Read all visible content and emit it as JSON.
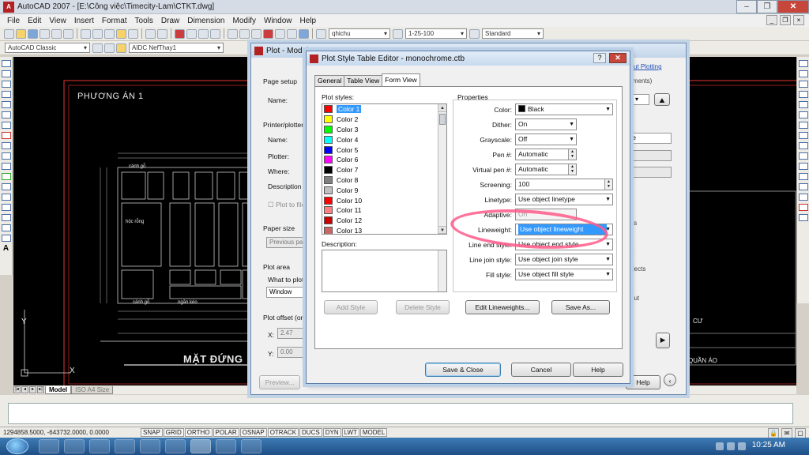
{
  "window": {
    "title": "AutoCAD 2007 - [E:\\Công việc\\Timecity-Lam\\CTKT.dwg]"
  },
  "menu": [
    "File",
    "Edit",
    "View",
    "Insert",
    "Format",
    "Tools",
    "Draw",
    "Dimension",
    "Modify",
    "Window",
    "Help"
  ],
  "toolbar": {
    "text_style": "qhichu",
    "dim_scale": "1-25-100",
    "table_style": "Standard",
    "workspace": "AutoCAD Classic",
    "layer": "AIDC NefThay1"
  },
  "canvas": {
    "option_title": "PHƯƠNG ÁN 1",
    "elevation_title": "MẶT ĐỨNG",
    "note_cabinet": "cánh gỗ",
    "note_shelf": "hộc rỗng",
    "note_drawer": "ngăn kéo",
    "right_label_1": "CƯ",
    "right_label_2": "QUẦN ÁO"
  },
  "layout_tabs": [
    "Model",
    "ISO A4 Size"
  ],
  "status": {
    "coords": "1294858.5000, -643732.0000, 0.0000",
    "buttons": [
      "SNAP",
      "GRID",
      "ORTHO",
      "POLAR",
      "OSNAP",
      "OTRACK",
      "DUCS",
      "DYN",
      "LWT",
      "MODEL"
    ]
  },
  "taskbar": {
    "clock": "10:25 AM"
  },
  "plot_dialog": {
    "title": "Plot - Model",
    "page_setup": "Page setup",
    "name_label": "Name:",
    "printer_plotter": "Printer/plotter",
    "printer_name_label": "Name:",
    "plotter_label": "Plotter:",
    "where_label": "Where:",
    "description_label": "Description",
    "plot_to_file": "Plot to file",
    "paper_size": "Paper size",
    "paper_value": "Previous pa",
    "plot_area": "Plot area",
    "what_to_plot": "What to plot:",
    "what_value": "Window",
    "plot_offset": "Plot offset (ori",
    "x_label": "X:",
    "x_value": "2.47",
    "y_label": "Y:",
    "y_value": "0.00",
    "preview_button": "Preview...",
    "help_button": "Help",
    "link_text": "ut Plotting",
    "right_text_1": "gnments)",
    "right_text_2": "ne",
    "right_text_3": "ts",
    "right_text_4": "t",
    "right_text_5": "objects",
    "right_text_6": "yout"
  },
  "pst": {
    "title": "Plot Style Table Editor - monochrome.ctb",
    "tabs": [
      "General",
      "Table View",
      "Form View"
    ],
    "active_tab": "Form View",
    "plot_styles_label": "Plot styles:",
    "styles": [
      {
        "name": "Color 1",
        "color": "#ff0000"
      },
      {
        "name": "Color 2",
        "color": "#ffff00"
      },
      {
        "name": "Color 3",
        "color": "#00ff00"
      },
      {
        "name": "Color 4",
        "color": "#00ffff"
      },
      {
        "name": "Color 5",
        "color": "#0000ff"
      },
      {
        "name": "Color 6",
        "color": "#ff00ff"
      },
      {
        "name": "Color 7",
        "color": "#000000"
      },
      {
        "name": "Color 8",
        "color": "#808080"
      },
      {
        "name": "Color 9",
        "color": "#c0c0c0"
      },
      {
        "name": "Color 10",
        "color": "#ff0000"
      },
      {
        "name": "Color 11",
        "color": "#ff8080"
      },
      {
        "name": "Color 12",
        "color": "#cc0000"
      },
      {
        "name": "Color 13",
        "color": "#cc6666"
      }
    ],
    "description_label": "Description:",
    "properties_label": "Properties",
    "props": {
      "color_label": "Color:",
      "color_value": "Black",
      "dither_label": "Dither:",
      "dither_value": "On",
      "grayscale_label": "Grayscale:",
      "grayscale_value": "Off",
      "pen_label": "Pen #:",
      "pen_value": "Automatic",
      "virtual_pen_label": "Virtual pen #:",
      "virtual_pen_value": "Automatic",
      "screening_label": "Screening:",
      "screening_value": "100",
      "linetype_label": "Linetype:",
      "linetype_value": "Use object linetype",
      "adaptive_label": "Adaptive:",
      "adaptive_value": "On",
      "lineweight_label": "Lineweight:",
      "lineweight_value": "Use object lineweight",
      "line_end_label": "Line end style:",
      "line_end_value": "Use object end style",
      "line_join_label": "Line join style:",
      "line_join_value": "Use object join style",
      "fill_label": "Fill style:",
      "fill_value": "Use object fill style"
    },
    "buttons": {
      "add_style": "Add Style",
      "delete_style": "Delete Style",
      "edit_lineweights": "Edit Lineweights...",
      "save_as": "Save As...",
      "save_close": "Save & Close",
      "cancel": "Cancel",
      "help": "Help"
    }
  }
}
